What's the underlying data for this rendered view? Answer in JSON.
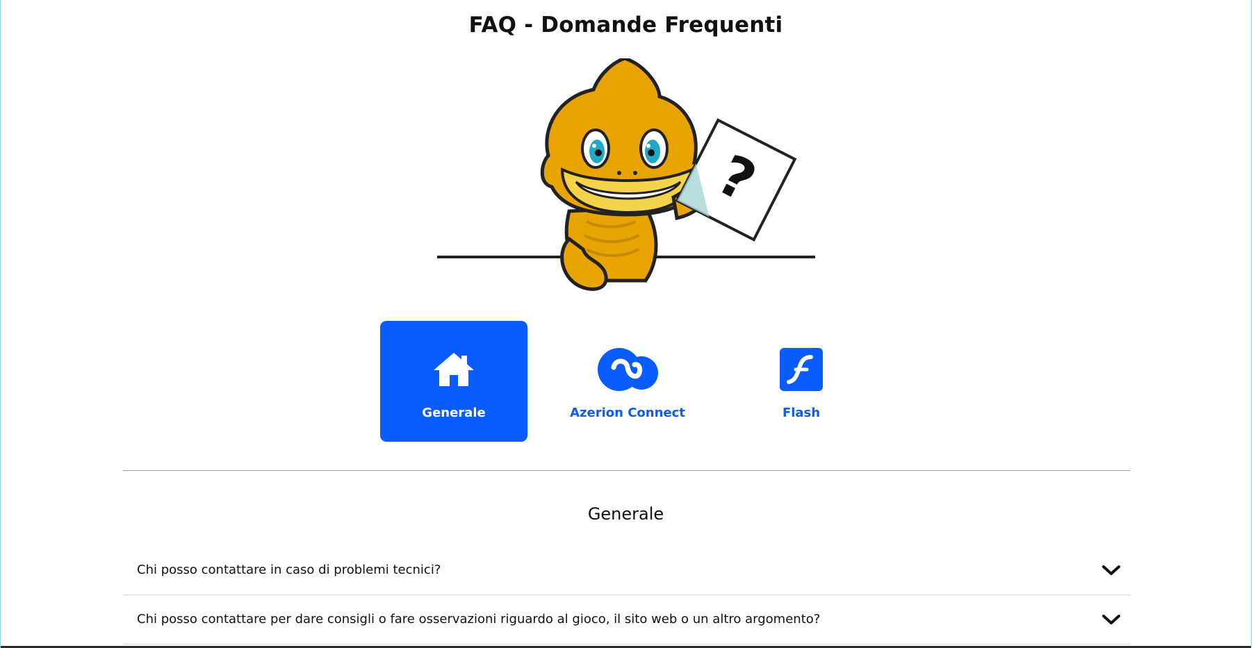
{
  "page": {
    "title": "FAQ - Domande Frequenti"
  },
  "mascot": {
    "icon": "dragon-mascot-question-icon",
    "sign_text": "?"
  },
  "categories": [
    {
      "label": "Generale",
      "icon": "home-icon",
      "active": true
    },
    {
      "label": "Azerion Connect",
      "icon": "azerion-connect-logo-icon",
      "active": false
    },
    {
      "label": "Flash",
      "icon": "flash-logo-icon",
      "active": false
    }
  ],
  "section": {
    "title": "Generale"
  },
  "faq": [
    {
      "question": "Chi posso contattare in caso di problemi tecnici?"
    },
    {
      "question": "Chi posso contattare per dare consigli o fare osservazioni riguardo al gioco, il sito web o un altro argomento?"
    }
  ],
  "colors": {
    "accent": "#0a5cff",
    "mascot": "#e8a400"
  }
}
